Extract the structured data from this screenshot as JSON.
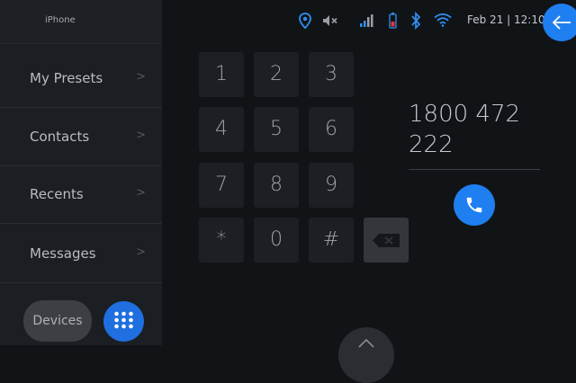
{
  "sidebar": {
    "device_name": "iPhone",
    "items": [
      {
        "label": "My Presets"
      },
      {
        "label": "Contacts"
      },
      {
        "label": "Recents"
      },
      {
        "label": "Messages"
      }
    ],
    "chevron": ">",
    "devices_label": "Devices"
  },
  "status": {
    "date_time": "Feb 21 | 12:10",
    "icons": [
      "location-pin-icon",
      "mute-icon",
      "signal-icon",
      "battery-icon",
      "bluetooth-icon",
      "wifi-icon"
    ]
  },
  "keypad": {
    "keys": [
      "1",
      "2",
      "3",
      "4",
      "5",
      "6",
      "7",
      "8",
      "9",
      "*",
      "0",
      "#"
    ]
  },
  "dialed": {
    "line1": "1800 472",
    "line2": "222"
  },
  "colors": {
    "accent": "#1f7ff0",
    "background": "#111417",
    "sidebar": "#1b1e22"
  }
}
